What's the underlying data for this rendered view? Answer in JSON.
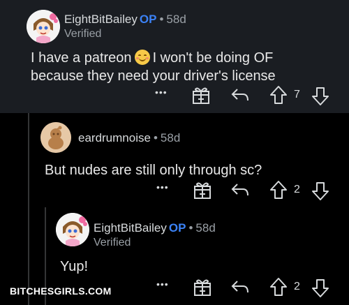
{
  "comments": [
    {
      "username": "EightBitBailey",
      "op_badge": "OP",
      "separator": "•",
      "age": "58d",
      "verified_label": "Verified",
      "body_line1_a": "I have a patreon",
      "body_line1_b": "I won't be doing OF",
      "body_line2": "because they need your driver's license",
      "emoji": "smiling-face-with-smiling-eyes",
      "more_label": "•••",
      "vote_count": "7"
    },
    {
      "username": "eardrumnoise",
      "separator": "•",
      "age": "58d",
      "body": "But nudes are still only through sc?",
      "more_label": "•••",
      "vote_count": "2"
    },
    {
      "username": "EightBitBailey",
      "op_badge": "OP",
      "separator": "•",
      "age": "58d",
      "verified_label": "Verified",
      "body": "Yup!",
      "more_label": "•••",
      "vote_count": "2"
    }
  ],
  "watermark": "BITCHESGIRLS.COM",
  "colors": {
    "op_badge": "#3b82f6",
    "background_top": "#1a1d22",
    "background": "#000000",
    "text": "#d7dadc",
    "muted": "#9aa0a6"
  }
}
